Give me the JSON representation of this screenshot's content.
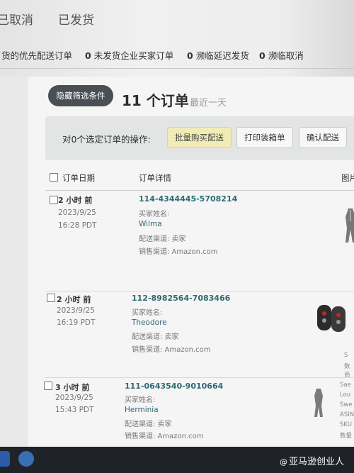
{
  "status_tabs": [
    "已取消",
    "已发货"
  ],
  "queue": [
    {
      "count": "",
      "label": "货的优先配送订单"
    },
    {
      "count": "0",
      "label": "未发货企业买家订单"
    },
    {
      "count": "0",
      "label": "濒临延迟发货"
    },
    {
      "count": "0",
      "label": "濒临取消"
    }
  ],
  "orders_header": {
    "filter_button": "隐藏筛选条件",
    "count_text": "11 个订单",
    "range_text": "最近一天"
  },
  "action_bar": {
    "label": "对0个选定订单的操作:",
    "buttons": [
      "批量购买配送",
      "打印装箱单",
      "确认配送"
    ]
  },
  "columns": {
    "order_date": "订单日期",
    "order_details": "订单详情",
    "image": "图片"
  },
  "orders": [
    {
      "time_ago": "2 小时 前",
      "date": "2023/9/25",
      "time": "16:28 PDT",
      "order_id": "114-4344445-5708214",
      "buyer_label": "买家姓名:",
      "buyer": "Wilma",
      "shipping": "配送渠道: 卖家",
      "sales_channel": "销售渠道: Amazon.com",
      "product_icon": "clothing-figure-icon"
    },
    {
      "time_ago": "2 小时 前",
      "date": "2023/9/25",
      "time": "16:19 PDT",
      "order_id": "112-8982564-7083466",
      "buyer_label": "买家姓名:",
      "buyer": "Theodore",
      "shipping": "配送渠道: 卖家",
      "sales_channel": "销售渠道: Amazon.com",
      "product_icon": "car-key-fob-icon"
    },
    {
      "time_ago": "3 小时 前",
      "date": "2023/9/25",
      "time": "15:43 PDT",
      "order_id": "111-0643540-9010664",
      "buyer_label": "买家姓名:",
      "buyer": "Herminia",
      "shipping": "配送渠道: 卖家",
      "sales_channel": "销售渠道: Amazon.com",
      "product_icon": "clothing-figure-icon"
    }
  ],
  "side_snippets": [
    "S",
    "数",
    "商",
    "Sae",
    "Lou",
    "Swe",
    "ASIN",
    "SKU",
    "数量"
  ],
  "watermark": "亚马逊创业人",
  "watermark_icon": "@",
  "colors": {
    "accent": "#2d6b73",
    "primary_button": "#f1ebb5",
    "filter_button": "#4a4f55"
  }
}
